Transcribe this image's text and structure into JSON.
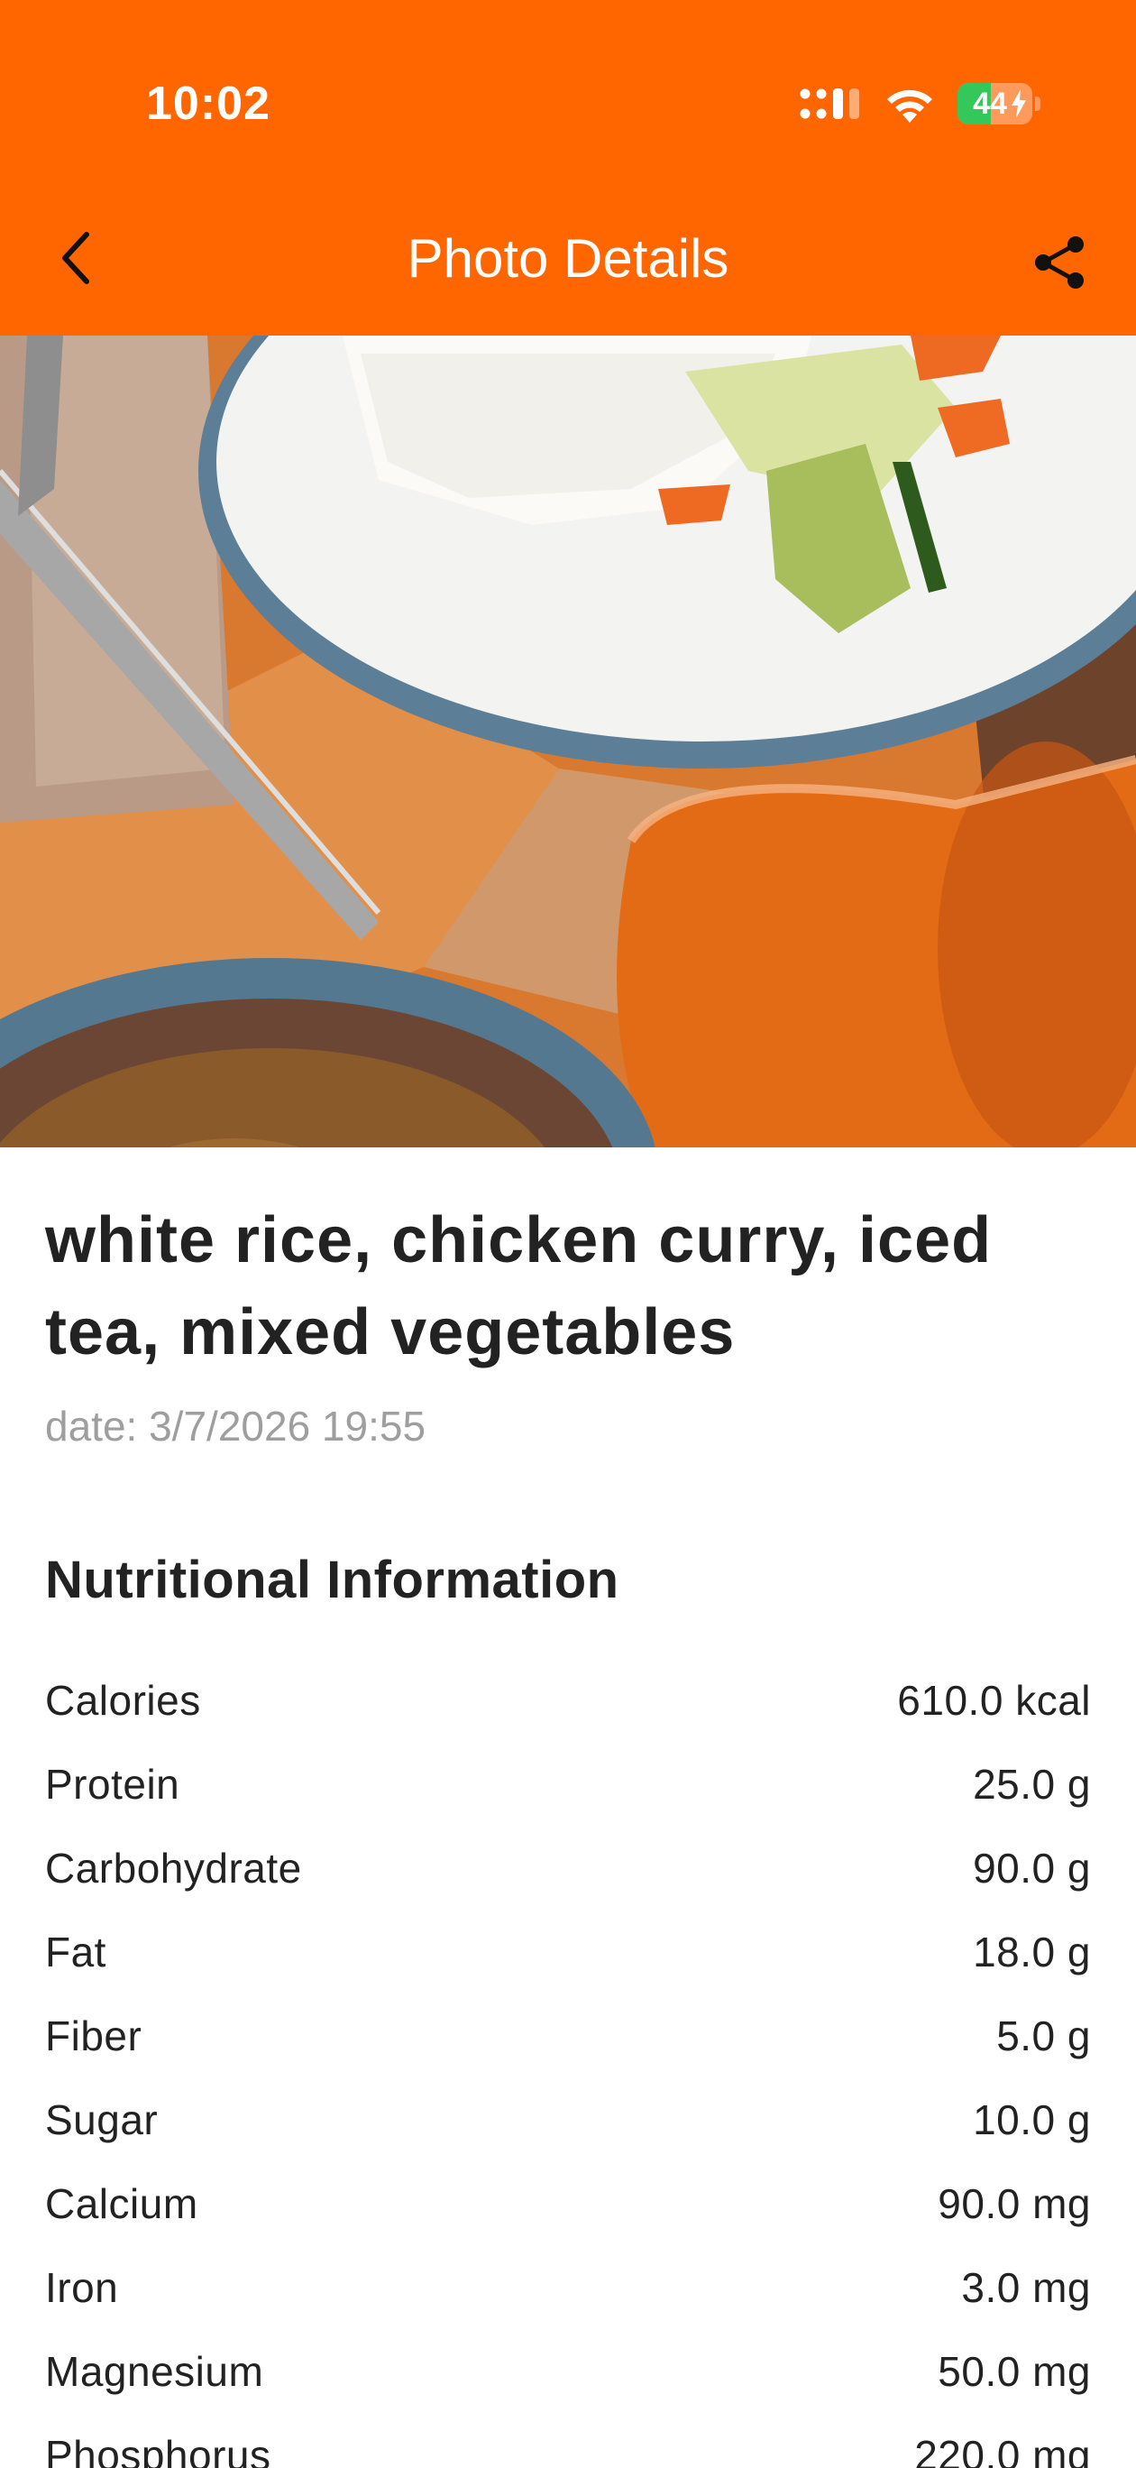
{
  "status_bar": {
    "time": "10:02",
    "battery_level": "44",
    "battery_percent": 44,
    "charging": true,
    "icons": [
      "signal-icon",
      "wifi-icon",
      "battery-icon",
      "bolt-icon"
    ]
  },
  "nav": {
    "back_icon": "chevron-left-icon",
    "title": "Photo Details",
    "share_icon": "share-icon"
  },
  "photo": {
    "subject": "food-photo"
  },
  "meal": {
    "title": "white rice, chicken curry, iced tea, mixed vegetables",
    "date": "date: 3/7/2026 19:55"
  },
  "nutrition": {
    "heading": "Nutritional Information",
    "items": [
      {
        "name": "Calories",
        "value": "610.0 kcal"
      },
      {
        "name": "Protein",
        "value": "25.0 g"
      },
      {
        "name": "Carbohydrate",
        "value": "90.0 g"
      },
      {
        "name": "Fat",
        "value": "18.0 g"
      },
      {
        "name": "Fiber",
        "value": "5.0 g"
      },
      {
        "name": "Sugar",
        "value": "10.0 g"
      },
      {
        "name": "Calcium",
        "value": "90.0 mg"
      },
      {
        "name": "Iron",
        "value": "3.0 mg"
      },
      {
        "name": "Magnesium",
        "value": "50.0 mg"
      },
      {
        "name": "Phosphorus",
        "value": "220.0 mg"
      }
    ]
  },
  "colors": {
    "brand": "#ff6600",
    "text_primary": "#222222",
    "text_secondary": "#9e9e9e",
    "battery_green": "#34c759"
  }
}
